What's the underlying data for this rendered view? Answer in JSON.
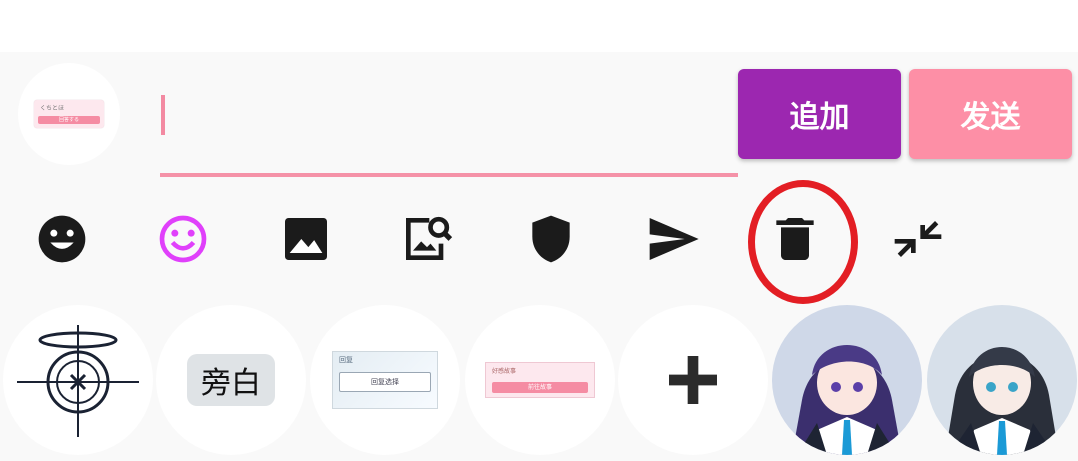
{
  "composer": {
    "input_value": "",
    "add_label": "追加",
    "send_label": "发送",
    "preview_card": {
      "text": "くちとほ",
      "button": "回答する"
    }
  },
  "colors": {
    "accent_pink": "#f592a8",
    "add_purple": "#9c27b0",
    "send_pink": "#fd8fa6",
    "highlight_red": "#e31e24",
    "emoji_magenta": "#e040fb"
  },
  "toolbar": {
    "icons": [
      "smiley-icon",
      "smiley-outline-icon",
      "image-icon",
      "image-search-icon",
      "shield-icon",
      "send-icon",
      "trash-icon",
      "collapse-icon"
    ]
  },
  "stickers": {
    "narration_label": "旁白",
    "choice_card": {
      "title": "回复",
      "button": "回复选择"
    },
    "pink_card": {
      "title": "好感故事",
      "button": "前往故事"
    }
  }
}
